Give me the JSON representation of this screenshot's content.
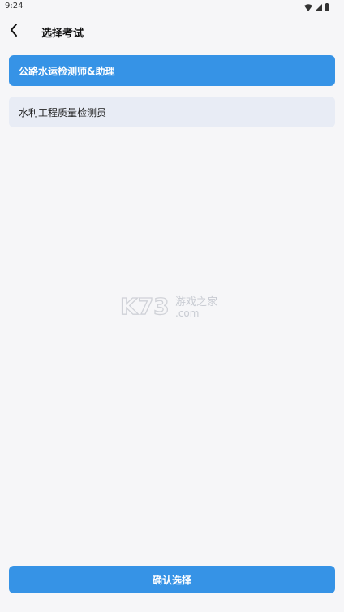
{
  "status_bar": {
    "time": "9:24",
    "icons": [
      "wifi-icon",
      "signal-icon",
      "battery-icon"
    ]
  },
  "header": {
    "title": "选择考试",
    "back_icon": "chevron-left-icon"
  },
  "options": [
    {
      "label": "公路水运检测师&助理",
      "selected": true
    },
    {
      "label": "水利工程质量检测员",
      "selected": false
    }
  ],
  "watermark": {
    "brand": "K73",
    "sub": "游戏之家",
    "domain": ".com"
  },
  "footer": {
    "confirm_label": "确认选择"
  },
  "colors": {
    "accent": "#3693e6",
    "unselected_bg": "#e8ecf5",
    "page_bg": "#f6f6f8"
  }
}
